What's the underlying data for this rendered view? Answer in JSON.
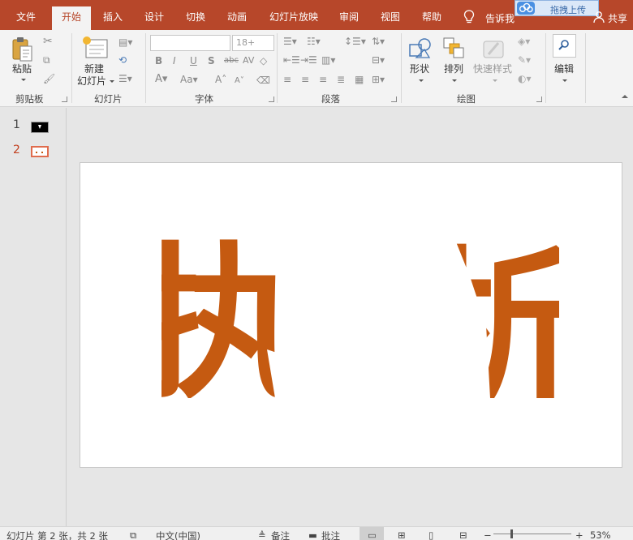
{
  "tabs": [
    {
      "label": "文件",
      "active": false
    },
    {
      "label": "开始",
      "active": true
    },
    {
      "label": "插入",
      "active": false
    },
    {
      "label": "设计",
      "active": false
    },
    {
      "label": "切换",
      "active": false
    },
    {
      "label": "动画",
      "active": false
    },
    {
      "label": "幻灯片放映",
      "active": false
    },
    {
      "label": "审阅",
      "active": false
    },
    {
      "label": "视图",
      "active": false
    },
    {
      "label": "帮助",
      "active": false
    }
  ],
  "tell_me": {
    "label": "告诉我",
    "icon": "lightbulb-icon"
  },
  "upload": {
    "label": "拖拽上传",
    "icon": "cloud-icon"
  },
  "share": {
    "label": "共享",
    "icon": "person-icon"
  },
  "ribbon": {
    "clipboard": {
      "paste_label": "粘贴",
      "group_label": "剪贴板"
    },
    "slides": {
      "new_slide_line1": "新建",
      "new_slide_line2": "幻灯片",
      "group_label": "幻灯片"
    },
    "font": {
      "font_name_value": "",
      "font_size_placeholder": "18+",
      "group_label": "字体",
      "buttons": [
        "B",
        "I",
        "U",
        "S",
        "abc",
        "AV"
      ]
    },
    "paragraph": {
      "group_label": "段落"
    },
    "drawing": {
      "shape_label": "形状",
      "arrange_label": "排列",
      "quick_styles_label": "快速样式",
      "group_label": "绘图"
    },
    "editing": {
      "edit_label": "编辑"
    }
  },
  "thumbnails": [
    {
      "number": "1",
      "selected": false
    },
    {
      "number": "2",
      "selected": true
    }
  ],
  "slide": {
    "char_left": "执",
    "char_right": "析",
    "color": "#c55a11"
  },
  "status": {
    "slide_info": "幻灯片 第 2 张，共 2 张",
    "language": "中文(中国)",
    "notes_label": "备注",
    "comments_label": "批注",
    "zoom": "53%"
  },
  "colors": {
    "accent": "#b7472a",
    "ribbon_bg": "#f3f3f3"
  }
}
